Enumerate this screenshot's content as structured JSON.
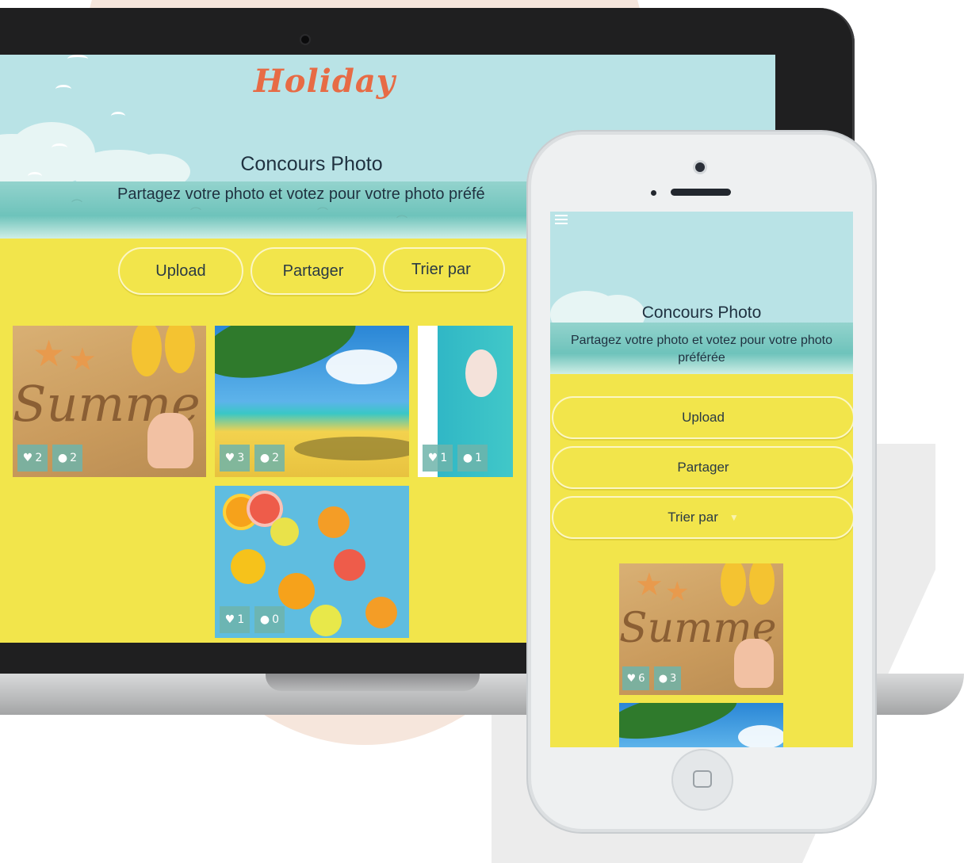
{
  "laptop": {
    "logo": "Holiday",
    "title": "Concours Photo",
    "subtitle": "Partagez votre photo et votez pour votre photo préfé",
    "buttons": {
      "upload": "Upload",
      "share": "Partager",
      "sort": "Trier par"
    },
    "photos": [
      {
        "scene": "summer-sand",
        "likes": "2",
        "comments": "2"
      },
      {
        "scene": "palm-beach",
        "likes": "3",
        "comments": "2"
      },
      {
        "scene": "pool",
        "likes": "1",
        "comments": "1"
      },
      {
        "scene": "citrus",
        "likes": "1",
        "comments": "0"
      }
    ]
  },
  "phone": {
    "title": "Concours Photo",
    "subtitle": "Partagez votre photo et votez pour votre photo préférée",
    "buttons": {
      "upload": "Upload",
      "share": "Partager",
      "sort": "Trier par"
    },
    "photos": [
      {
        "scene": "summer-sand",
        "likes": "6",
        "comments": "3"
      },
      {
        "scene": "palm-beach"
      }
    ]
  },
  "icons": [
    "heart-icon",
    "comment-icon",
    "hamburger-menu-icon",
    "chevron-down-icon",
    "home-button-icon"
  ],
  "colors": {
    "sand": "#f2e54b",
    "sky": "#b9e3e6",
    "sea": "#6ec3bb",
    "logo": "#e76b45",
    "badge": "#6eb4aa"
  }
}
